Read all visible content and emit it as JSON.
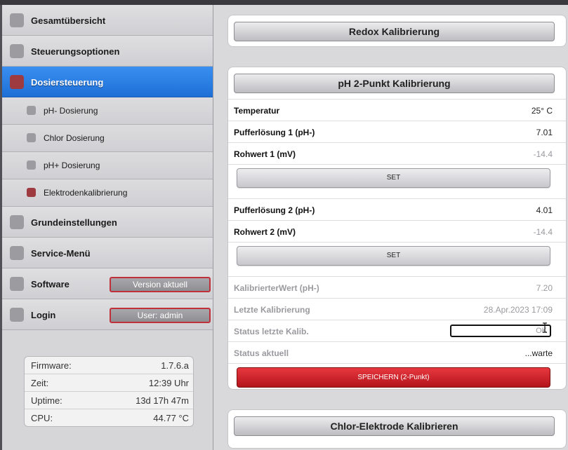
{
  "sidebar": {
    "items": [
      {
        "label": "Gesamtübersicht"
      },
      {
        "label": "Steuerungsoptionen"
      },
      {
        "label": "Dosiersteuerung"
      },
      {
        "label": "pH- Dosierung"
      },
      {
        "label": "Chlor Dosierung"
      },
      {
        "label": "pH+ Dosierung"
      },
      {
        "label": "Elektrodenkalibrierung"
      },
      {
        "label": "Grundeinstellungen"
      },
      {
        "label": "Service-Menü"
      },
      {
        "label": "Software",
        "badge": "Version aktuell"
      },
      {
        "label": "Login",
        "badge": "User: admin"
      }
    ],
    "info": [
      {
        "key": "Firmware:",
        "value": "1.7.6.a"
      },
      {
        "key": "Zeit:",
        "value": "12:39 Uhr"
      },
      {
        "key": "Uptime:",
        "value": "13d 17h 47m"
      },
      {
        "key": "CPU:",
        "value": "44.77 °C"
      }
    ]
  },
  "main": {
    "redox_title": "Redox Kalibrierung",
    "ph_title": "pH 2-Punkt Kalibrierung",
    "rows": {
      "temperatur": {
        "label": "Temperatur",
        "value": "25° C"
      },
      "puffer1": {
        "label": "Pufferlösung 1 (pH-)",
        "value": "7.01"
      },
      "rohwert1": {
        "label": "Rohwert 1 (mV)",
        "value": "-14.4"
      },
      "puffer2": {
        "label": "Pufferlösung 2 (pH-)",
        "value": "4.01"
      },
      "rohwert2": {
        "label": "Rohwert 2 (mV)",
        "value": "-14.4"
      },
      "kalibriert": {
        "label": "KalibrierterWert (pH-)",
        "value": "7.20"
      },
      "letzte": {
        "label": "Letzte Kalibrierung",
        "value": "28.Apr.2023  17:09"
      },
      "status_letzte": {
        "label": "Status letzte Kalib.",
        "value": "OK"
      },
      "status_aktuell": {
        "label": "Status aktuell",
        "value": "...warte"
      }
    },
    "set_label": "SET",
    "save_label": "SPEICHERN (2-Punkt)",
    "chlor_title": "Chlor-Elektrode Kalibrieren"
  },
  "colors": {
    "accent": "#1d6fd6",
    "danger": "#c0303a",
    "save": "#b3141b"
  }
}
